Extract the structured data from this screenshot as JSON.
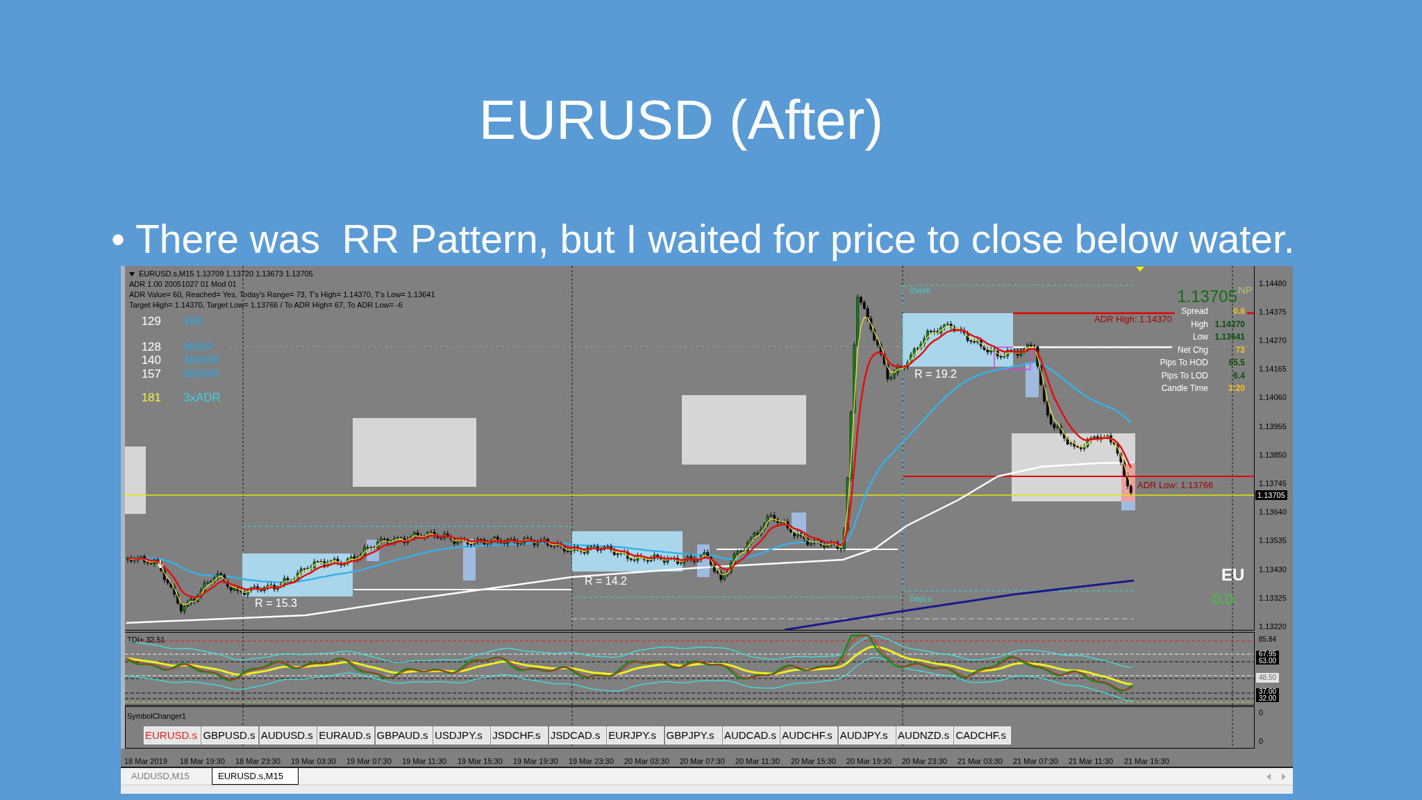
{
  "slide": {
    "title": "EURUSD (After)",
    "bullet": {
      "marker": "•",
      "text": "There was  RR Pattern, but I waited for price to close below water."
    }
  },
  "chart_window": {
    "header": "EURUSD.s,M15 1.13709 1.13720 1.13673 1.13705",
    "adr_lines": [
      "ADR 1.00 20051027 01 Mod 01",
      "ADR Value= 60, Reached= Yes, Today's Range= 73, T's High= 1.14370, T's Low= 1.13641",
      "Target High= 1.14370, Target Low= 1.13766 / To ADR High= 67, To ADR Low= -6"
    ],
    "range_stats": [
      {
        "value": "129",
        "label": "WR",
        "kind": "range"
      },
      {
        "value": "128",
        "label": "MWR",
        "kind": "range"
      },
      {
        "value": "140",
        "label": "3MWR",
        "kind": "range"
      },
      {
        "value": "157",
        "label": "6MWR",
        "kind": "range"
      },
      {
        "value": "181",
        "label": "3xADR",
        "kind": "adr"
      }
    ],
    "last_price": "1.13705",
    "np_label": "NP",
    "info_panel": [
      {
        "label": "Spread",
        "value": "0.8",
        "color": "#f2c01e"
      },
      {
        "label": "High",
        "value": "1.14370",
        "color": "#0b4f0b"
      },
      {
        "label": "Low",
        "value": "1.13641",
        "color": "#0b4f0b"
      },
      {
        "label": "Net Chg",
        "value": "73",
        "color": "#f2c01e"
      },
      {
        "label": "Pips To HOD",
        "value": "65.5",
        "color": "#0b4f0b"
      },
      {
        "label": "Pips To LOD",
        "value": "6.4",
        "color": "#0b4f0b"
      },
      {
        "label": "Candle Time",
        "value": "3:20",
        "color": "#f2c01e"
      }
    ],
    "adr_high_label": "ADR High: 1.14370",
    "adr_low_label": "ADR Low: 1.13766",
    "day_high_label": "DayHi",
    "day_low_label": "DayLo",
    "range_labels": [
      "R = 19.2",
      "R = 14.2",
      "R = 15.3"
    ],
    "pair_code": "EU",
    "pair_change": "0.0",
    "price_axis": {
      "ticks": [
        "1.14480",
        "1.14375",
        "1.14270",
        "1.14165",
        "1.14060",
        "1.13955",
        "1.13850",
        "1.13745",
        "1.13640",
        "1.13535",
        "1.13430",
        "1.13325",
        "1.13220"
      ],
      "current": "1.13705"
    },
    "indicator": {
      "title": "TDI+ 32.51",
      "axis_labels": [
        {
          "text": "85.84",
          "kind": "plain"
        },
        {
          "text": "67.95",
          "kind": "dark"
        },
        {
          "text": "63.00",
          "kind": "dark"
        },
        {
          "text": "48.50",
          "kind": "light"
        },
        {
          "text": "37.00",
          "kind": "dark"
        },
        {
          "text": "32.00",
          "kind": "dark"
        }
      ]
    },
    "symbol_changer": {
      "title": "SymbolChanger1",
      "buttons": [
        {
          "label": "EURUSD.s",
          "selected": true
        },
        {
          "label": "GBPUSD.s",
          "selected": false
        },
        {
          "label": "AUDUSD.s",
          "selected": false
        },
        {
          "label": "EURAUD.s",
          "selected": false
        },
        {
          "label": "GBPAUD.s",
          "selected": false
        },
        {
          "label": "USDJPY.s",
          "selected": false
        },
        {
          "label": "JSDCHF.s",
          "selected": false
        },
        {
          "label": "JSDCAD.s",
          "selected": false
        },
        {
          "label": "EURJPY.s",
          "selected": false
        },
        {
          "label": "GBPJPY.s",
          "selected": false
        },
        {
          "label": "AUDCAD.s",
          "selected": false
        },
        {
          "label": "AUDCHF.s",
          "selected": false
        },
        {
          "label": "AUDJPY.s",
          "selected": false
        },
        {
          "label": "AUDNZD.s",
          "selected": false
        },
        {
          "label": "CADCHF.s",
          "selected": false
        }
      ],
      "axis_labels": [
        "0",
        "0"
      ]
    },
    "time_axis": [
      "18 Mar 2019",
      "18 Mar 19:30",
      "18 Mar 23:30",
      "19 Mar 03:30",
      "19 Mar 07:30",
      "19 Mar 11:30",
      "19 Mar 15:30",
      "19 Mar 19:30",
      "19 Mar 23:30",
      "20 Mar 03:30",
      "20 Mar 07:30",
      "20 Mar 11:30",
      "20 Mar 15:30",
      "20 Mar 19:30",
      "20 Mar 23:30",
      "21 Mar 03:30",
      "21 Mar 07:30",
      "21 Mar 11:30",
      "21 Mar 15:30"
    ],
    "tabs": [
      {
        "label": "AUDUSD,M15",
        "selected": false
      },
      {
        "label": "EURUSD.s,M15",
        "selected": true
      }
    ]
  }
}
